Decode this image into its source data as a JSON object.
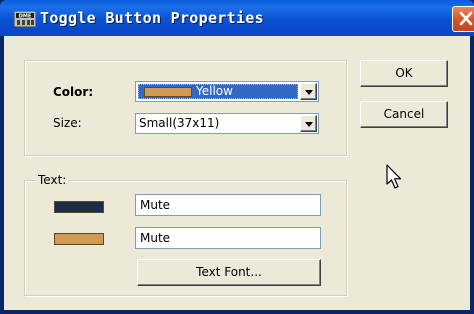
{
  "window": {
    "title": "Toggle Button Properties",
    "icon_name": "dme-app-icon",
    "close_label": "✕"
  },
  "color": {
    "label": "Color:",
    "selected": "Yellow",
    "swatch_color": "#d29a50"
  },
  "size": {
    "label": "Size:",
    "selected": "Small(37x11)"
  },
  "text_group": {
    "label": "Text:",
    "off_swatch_color": "#1e2a4a",
    "on_swatch_color": "#d29a50",
    "off_text": "Mute",
    "on_text": "Mute",
    "font_button_label": "Text Font..."
  },
  "buttons": {
    "ok": "OK",
    "cancel": "Cancel"
  },
  "colors": {
    "selection": "#316ac5",
    "titlebar": "#0a52d3"
  }
}
